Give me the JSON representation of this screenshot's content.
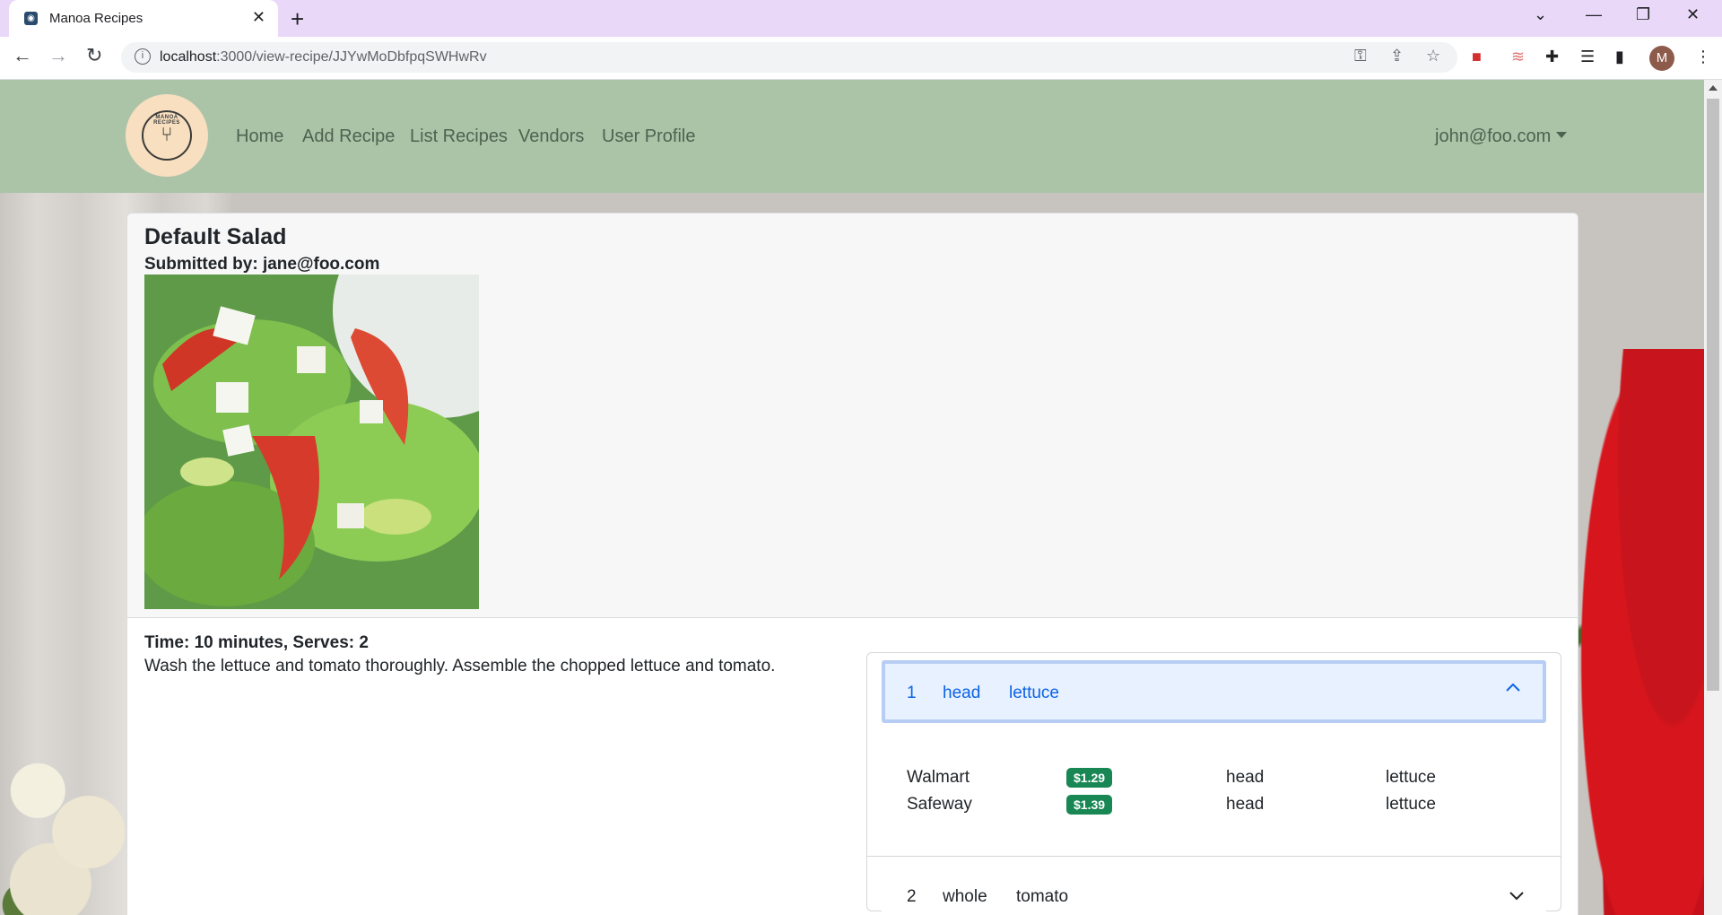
{
  "browser": {
    "tab_title": "Manoa Recipes",
    "tab_close": "✕",
    "new_tab": "+",
    "url_host": "localhost",
    "url_rest": ":3000/view-recipe/JJYwMoDbfpqSWHwRv",
    "avatar_letter": "M"
  },
  "navbar": {
    "links": [
      "Home",
      "Add Recipe",
      "List Recipes",
      "Vendors",
      "User Profile"
    ],
    "user": "john@foo.com"
  },
  "recipe": {
    "title": "Default Salad",
    "submitted_by": "Submitted by: jane@foo.com",
    "meta": "Time: 10 minutes, Serves: 2",
    "instructions": "Wash the lettuce and tomato thoroughly. Assemble the chopped lettuce and tomato."
  },
  "ingredients": [
    {
      "quantity": "1",
      "unit": "head",
      "name": "lettuce",
      "expanded": true,
      "vendors": [
        {
          "vendor": "Walmart",
          "price": "$1.29",
          "unit": "head",
          "name": "lettuce"
        },
        {
          "vendor": "Safeway",
          "price": "$1.39",
          "unit": "head",
          "name": "lettuce"
        }
      ]
    },
    {
      "quantity": "2",
      "unit": "whole",
      "name": "tomato",
      "expanded": false
    }
  ],
  "colors": {
    "navbar": "#abc4a8",
    "accent": "#0c63e4",
    "badge": "#198754",
    "tabbar": "#e9d8f8"
  }
}
